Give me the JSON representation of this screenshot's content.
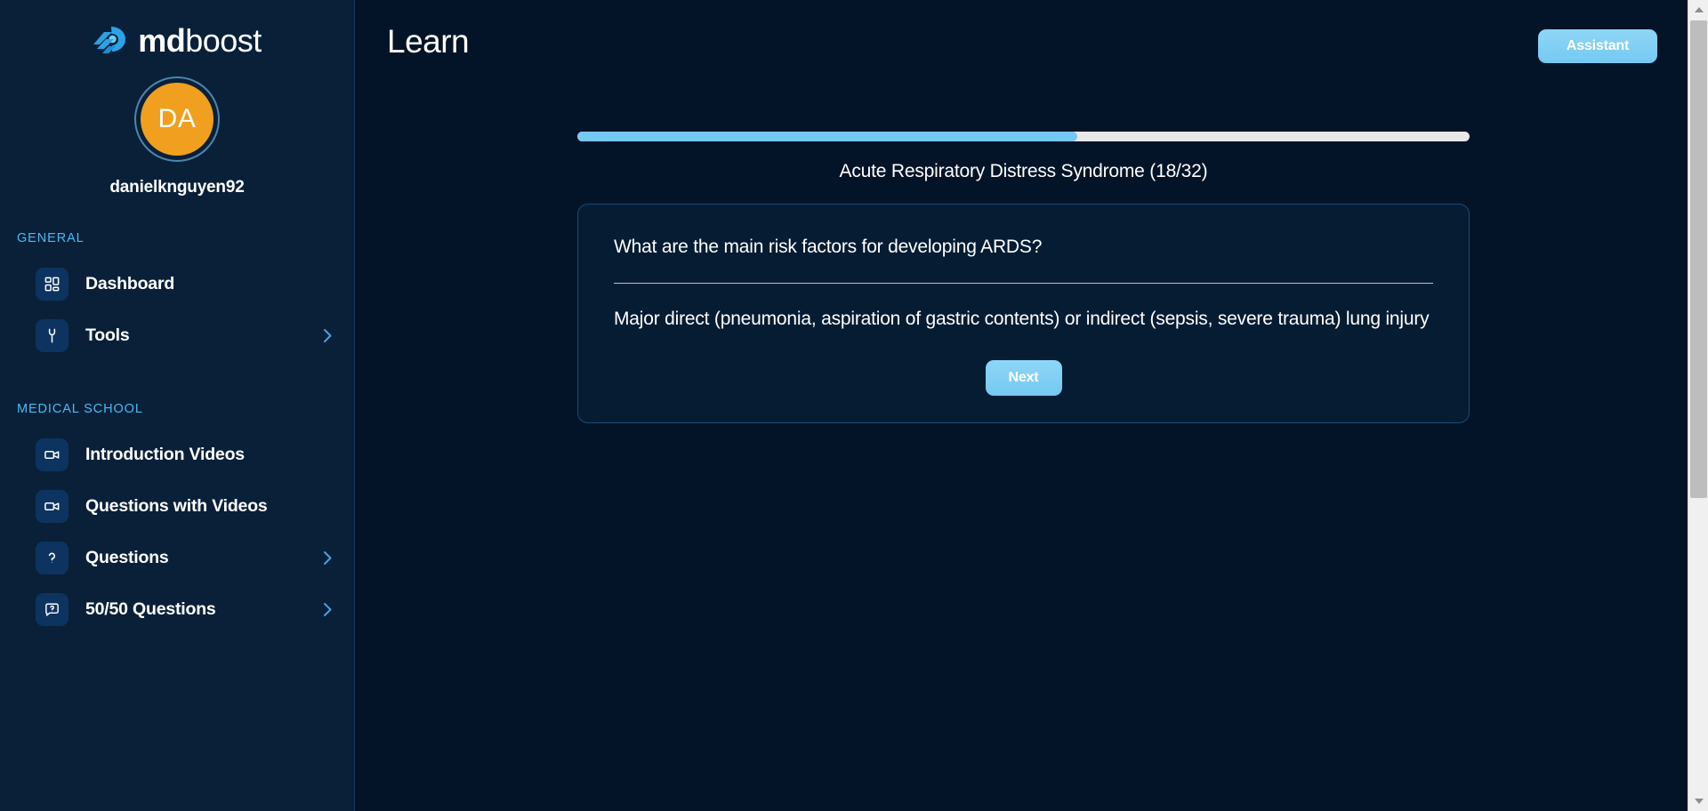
{
  "app": {
    "logo_md": "md",
    "logo_boost": "boost",
    "logo_mark_icon": "mdboost-rocket-mark-icon"
  },
  "sidebar": {
    "user": {
      "initials": "DA",
      "username": "danielknguyen92"
    },
    "sections": [
      {
        "label": "GENERAL",
        "items": [
          {
            "label": "Dashboard",
            "icon": "grid-dashboard-icon",
            "chevron": false
          },
          {
            "label": "Tools",
            "icon": "wrench-icon",
            "chevron": true
          }
        ]
      },
      {
        "label": "MEDICAL SCHOOL",
        "items": [
          {
            "label": "Introduction Videos",
            "icon": "video-camera-icon",
            "chevron": false
          },
          {
            "label": "Questions with Videos",
            "icon": "video-camera-icon",
            "chevron": false
          },
          {
            "label": "Questions",
            "icon": "question-mark-icon",
            "chevron": true
          },
          {
            "label": "50/50 Questions",
            "icon": "message-question-icon",
            "chevron": true
          }
        ]
      }
    ]
  },
  "header": {
    "title": "Learn",
    "assistant_label": "Assistant"
  },
  "quiz": {
    "progress_percent": 56,
    "progress_fill_width": "56%",
    "title": "Acute Respiratory Distress Syndrome (18/32)",
    "current_index": 18,
    "total": 32,
    "question": "What are the main risk factors for developing ARDS?",
    "answer": "Major direct (pneumonia, aspiration of gastric contents) or indirect (sepsis, severe trauma) lung injury",
    "next_label": "Next"
  },
  "scrollbar": {
    "up_icon": "scroll-up-arrow-icon",
    "down_icon": "scroll-down-arrow-icon"
  },
  "colors": {
    "sidebar_bg": "#0a2039",
    "main_bg": "#041428",
    "accent_blue": "#74c9f2",
    "section_label": "#4bb9f0",
    "avatar_orange": "#f0a01e",
    "card_border": "#1b4a79"
  }
}
